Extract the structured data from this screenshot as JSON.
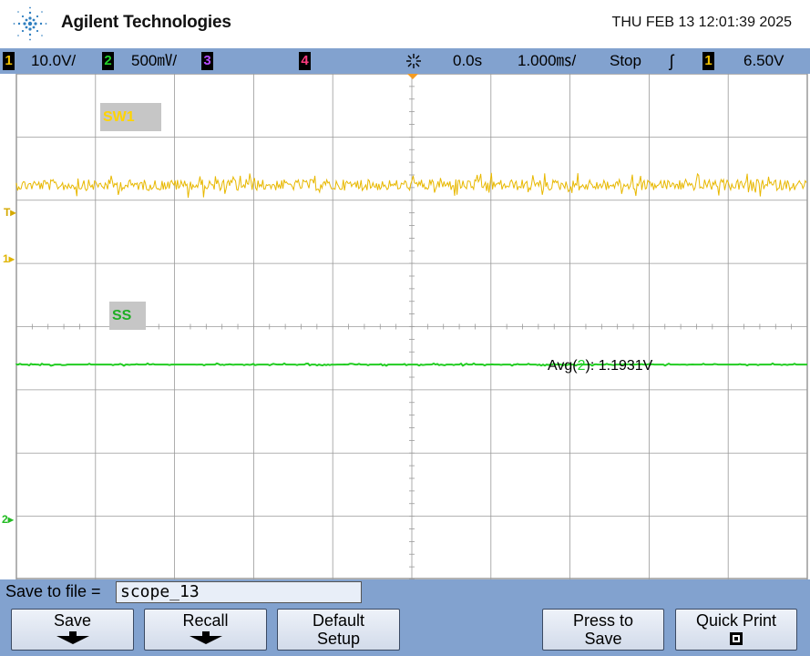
{
  "header": {
    "brand": "Agilent Technologies",
    "datetime": "THU FEB 13 12:01:39 2025"
  },
  "status_bar": {
    "ch1": {
      "num": "1",
      "scale": "10.0V/",
      "color": "#f2c200"
    },
    "ch2": {
      "num": "2",
      "scale": "500㎷/",
      "color": "#22d12a"
    },
    "ch3": {
      "num": "3",
      "color": "#b54cff"
    },
    "ch4": {
      "num": "4",
      "color": "#ff3b7f"
    },
    "delay": "0.0s",
    "timebase": "1.000㎳/",
    "run_state": "Stop",
    "trigger_slope": "ʃ",
    "trigger_source": "1",
    "trigger_level": "6.50V"
  },
  "screen": {
    "ch1_label": "SW1",
    "ch2_label": "SS",
    "marker_T": "T",
    "marker_1": "1",
    "marker_2": "2",
    "measurement": {
      "prefix": "Avg(",
      "channel": "2",
      "suffix": "): 1.1931V"
    }
  },
  "softkeys": {
    "save_to_file_label": "Save to file =",
    "filename": "scope_13",
    "save": "Save",
    "recall": "Recall",
    "default_setup_line1": "Default",
    "default_setup_line2": "Setup",
    "press_to_save_line1": "Press to",
    "press_to_save_line2": "Save",
    "quick_print": "Quick Print"
  },
  "colors": {
    "ch1_trace": "#e8b800",
    "ch2_trace": "#22cc22",
    "grid": "#9a9a9a",
    "chrome": "#82a2cf"
  },
  "traces": {
    "ch1_level_fraction_from_top": 0.22,
    "ch2_level_fraction_from_top": 0.575
  }
}
